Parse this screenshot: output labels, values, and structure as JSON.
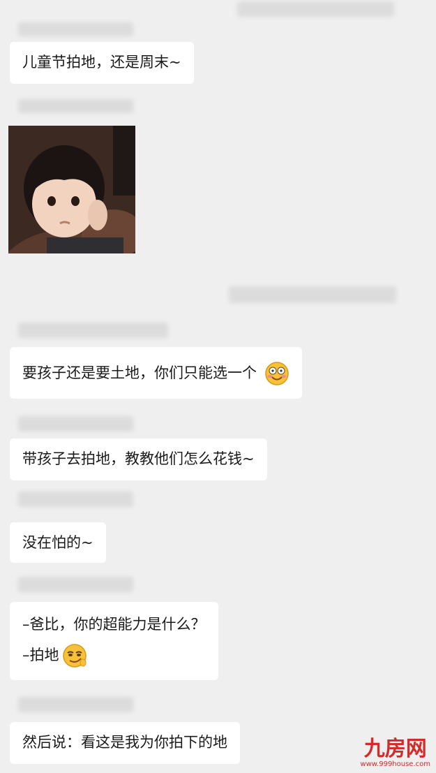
{
  "messages": [
    {
      "text": "儿童节拍地，还是周末~"
    },
    {
      "text": "要孩子还是要土地，你们只能选一个",
      "emoji": "blushing-smile-emoji"
    },
    {
      "text": "带孩子去拍地，教教他们怎么花钱~"
    },
    {
      "text": "没在怕的~"
    },
    {
      "line1": "–爸比，你的超能力是什么？",
      "line2": "–拍地",
      "emoji": "smug-grin-emoji"
    },
    {
      "text": "然后说：看这是我为你拍下的地"
    }
  ],
  "image_message": {
    "icon": "child-photo"
  },
  "watermark": {
    "logo": "九房网",
    "url": "www.999house.com"
  },
  "colors": {
    "background": "#efefef",
    "bubble": "#ffffff",
    "watermark": "#d42a2a"
  }
}
